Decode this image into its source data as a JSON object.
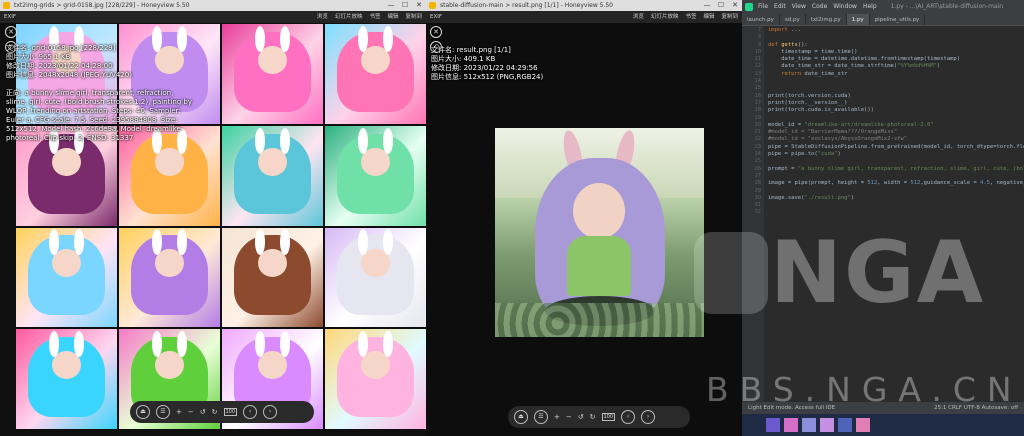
{
  "left_window": {
    "title": "txt2img-grids > grid-0158.jpg [228/229] - Honeyview 5.50",
    "toolbar_left": "EXIF",
    "toolbar_items": [
      "浏览",
      "幻灯片放映",
      "书签",
      "编辑",
      "复制到"
    ],
    "info_lines": [
      "文件名: grid-0158.jpg [228/229]",
      "图片大小: 965.1 KB",
      "修改日期: 2023/01/22 04:28:00",
      "图片信息: 2048x2048 (JPEG,YUV420)"
    ],
    "prompt_text": "正向: a bunny slime girl, transparent, refraction, slime, girl, cute, (bold brush strokes:1.2), painting by WLOP, trending on artstation, Steps: 40, Sampler: Euler a, CFG scale: 7.5, Seed: 2395884808, Size: 512x512, Model hash: 2c6de9a, Model: dreamlike-photoreal, Clip skip: 2, ENSD: 31337",
    "cell_palettes": [
      [
        "#f4a7e4",
        "#bfe8ff",
        "#7cd3ff"
      ],
      [
        "#c08cf0",
        "#ffe7f7",
        "#ff8fd1"
      ],
      [
        "#ff6fc2",
        "#fdd3e7",
        "#e93e9a"
      ],
      [
        "#ff74b4",
        "#ffd2e8",
        "#7ce0ff"
      ],
      [
        "#7a2b6b",
        "#ffd0e0",
        "#ff9ac8"
      ],
      [
        "#ffb347",
        "#ffe2d1",
        "#ff5fa2"
      ],
      [
        "#5bc6d9",
        "#ffe5f1",
        "#3ad29f"
      ],
      [
        "#6fe0a8",
        "#e6fff2",
        "#2bb07f"
      ],
      [
        "#7ad6ff",
        "#ffe4f7",
        "#ffd35a"
      ],
      [
        "#b37de6",
        "#ffe9d8",
        "#ffd15c"
      ],
      [
        "#8c4b2f",
        "#fff1e6",
        "#f5e4d4"
      ],
      [
        "#e6e6f0",
        "#ffffff",
        "#d6b9f5"
      ],
      [
        "#39d5ff",
        "#ffd7f0",
        "#ff5a9e"
      ],
      [
        "#5fcf3c",
        "#e8ffd6",
        "#f67ac8"
      ],
      [
        "#d98bff",
        "#ffffff",
        "#f0a8ff"
      ],
      [
        "#ffb3e0",
        "#e0fbff",
        "#ffd77a"
      ]
    ],
    "zoom_label": "100"
  },
  "right_window": {
    "title": "stable-diffusion-main > result.png [1/1] - Honeyview 5.50",
    "toolbar_left": "EXIF",
    "toolbar_items": [
      "浏览",
      "幻灯片放映",
      "书签",
      "编辑",
      "复制到"
    ],
    "info_lines": [
      "文件名: result.png [1/1]",
      "图片大小: 409.1 KB",
      "修改日期: 2023/01/22 04:29:56",
      "图片信息: 512x512 (PNG,RGB24)"
    ],
    "zoom_label": "100"
  },
  "editor": {
    "menu": [
      "File",
      "Edit",
      "View",
      "Code",
      "Window",
      "Help"
    ],
    "window_title": "1.py - ...\\AI_ART\\stable-diffusion-main",
    "tabs": [
      "launch.py",
      "sd.py",
      "txt2img.py",
      "1.py",
      "pipeline_utils.py"
    ],
    "active_tab": "1.py",
    "line_numbers": [
      "7",
      "8",
      "9",
      "10",
      "11",
      "12",
      "13",
      "14",
      "15",
      "16",
      "17",
      "18",
      "19",
      "20",
      "21",
      "22",
      "23",
      "24",
      "25",
      "26",
      "27",
      "28",
      "29",
      "30",
      "31",
      "32"
    ],
    "status_left": "Light Edit mode. Access full IDE",
    "status_right": "25:1  CRLF  UTF-8  Autosave: off"
  },
  "watermark": {
    "brand": "NGA",
    "url": "BBS.NGA.CN"
  },
  "colors": {
    "viewer_bg": "#111111",
    "editor_bg": "#2b2b2b",
    "taskbar": "#1f2a44"
  }
}
